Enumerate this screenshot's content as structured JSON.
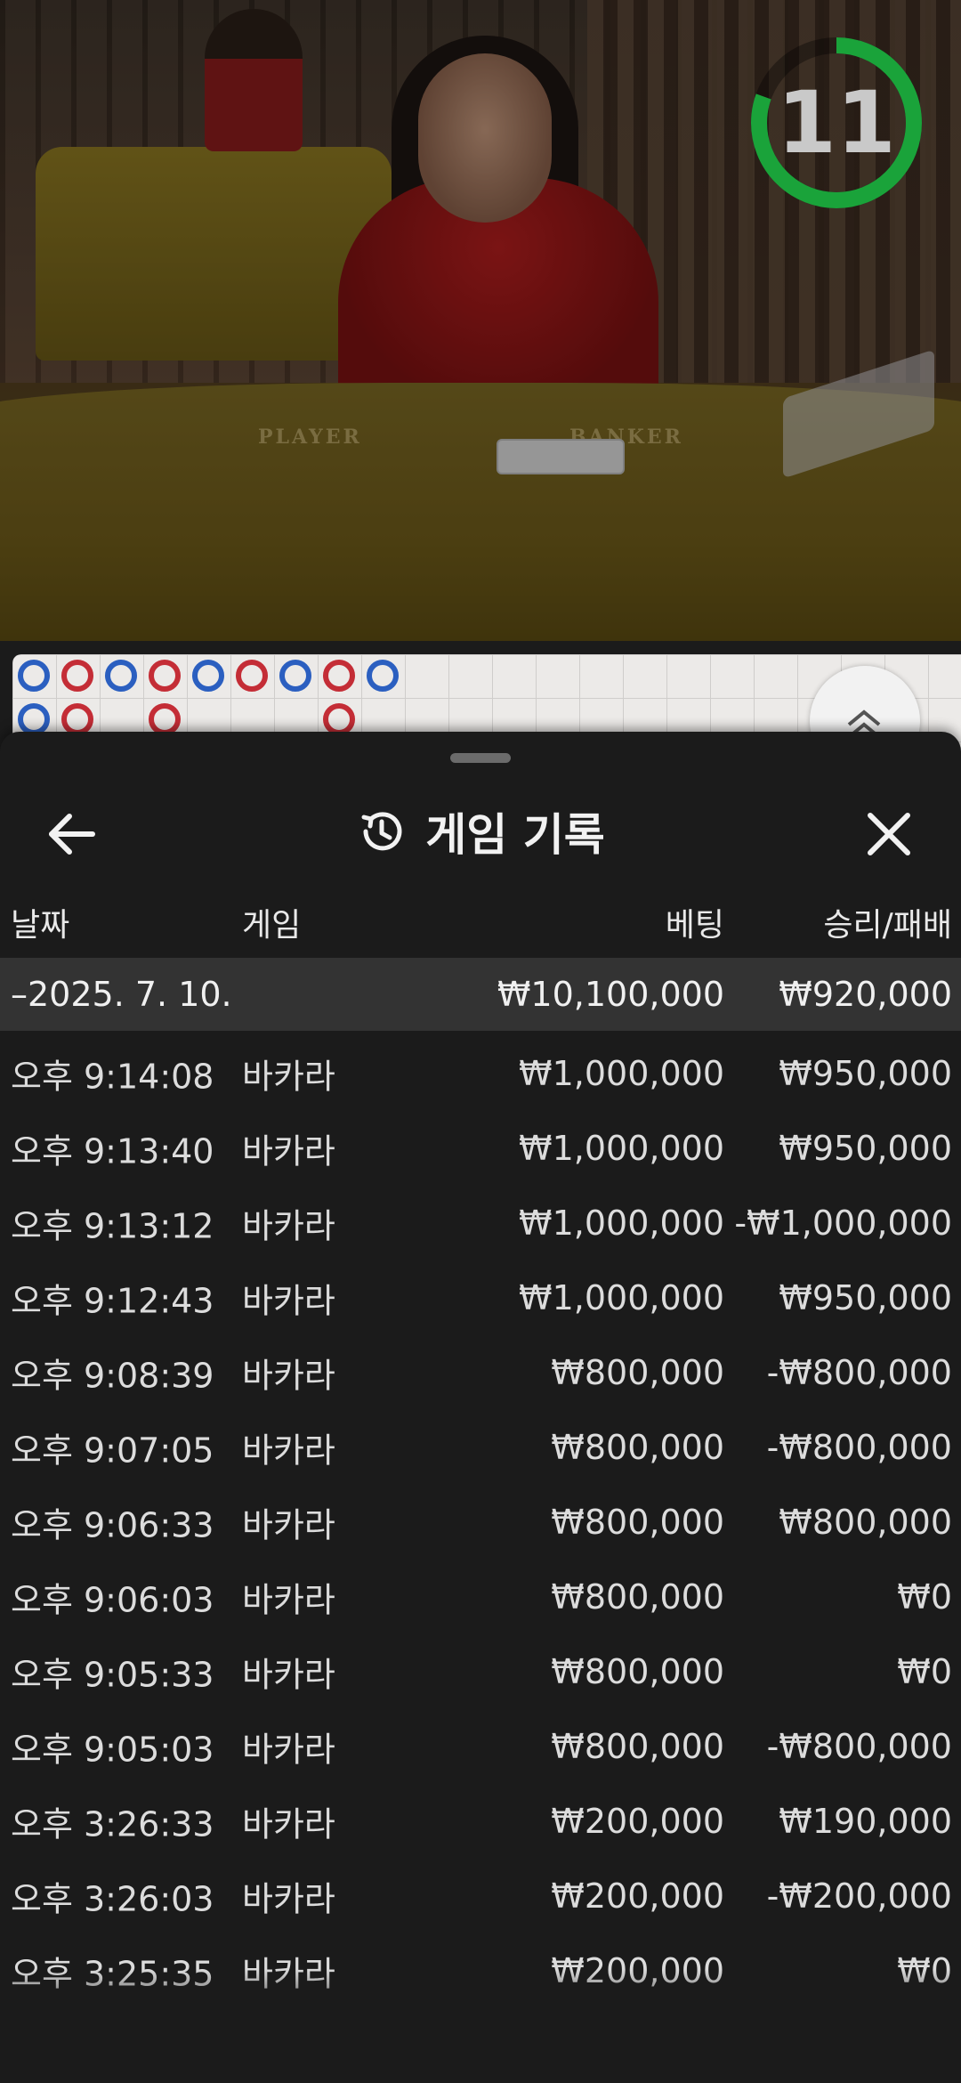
{
  "timer": {
    "value": "11",
    "ring_color": "#1aa33a"
  },
  "bead_road": {
    "colors": {
      "player": "#2b5fc0",
      "banker": "#c42d36"
    },
    "columns": [
      [
        "player",
        "player"
      ],
      [
        "banker",
        "banker"
      ],
      [
        "player"
      ],
      [
        "banker",
        "banker"
      ],
      [
        "player"
      ],
      [
        "banker"
      ],
      [
        "player"
      ],
      [
        "banker",
        "banker"
      ],
      [
        "player"
      ]
    ]
  },
  "video": {
    "felt_left": "PLAYER",
    "felt_right": "BANKER"
  },
  "sheet": {
    "title": "게임 기록",
    "title_icon": "history-icon",
    "back_icon": "arrow-left-icon",
    "close_icon": "close-icon",
    "columns": {
      "date": "날짜",
      "game": "게임",
      "bet": "베팅",
      "result": "승리/패배"
    },
    "date_group": {
      "label": "–2025. 7. 10.",
      "bet_total": "₩10,100,000",
      "result_total": "₩920,000"
    },
    "rows": [
      {
        "time": "오후 9:14:08",
        "game": "바카라",
        "bet": "₩1,000,000",
        "result": "₩950,000"
      },
      {
        "time": "오후 9:13:40",
        "game": "바카라",
        "bet": "₩1,000,000",
        "result": "₩950,000"
      },
      {
        "time": "오후 9:13:12",
        "game": "바카라",
        "bet": "₩1,000,000",
        "result": "-₩1,000,000"
      },
      {
        "time": "오후 9:12:43",
        "game": "바카라",
        "bet": "₩1,000,000",
        "result": "₩950,000"
      },
      {
        "time": "오후 9:08:39",
        "game": "바카라",
        "bet": "₩800,000",
        "result": "-₩800,000"
      },
      {
        "time": "오후 9:07:05",
        "game": "바카라",
        "bet": "₩800,000",
        "result": "-₩800,000"
      },
      {
        "time": "오후 9:06:33",
        "game": "바카라",
        "bet": "₩800,000",
        "result": "₩800,000"
      },
      {
        "time": "오후 9:06:03",
        "game": "바카라",
        "bet": "₩800,000",
        "result": "₩0"
      },
      {
        "time": "오후 9:05:33",
        "game": "바카라",
        "bet": "₩800,000",
        "result": "₩0"
      },
      {
        "time": "오후 9:05:03",
        "game": "바카라",
        "bet": "₩800,000",
        "result": "-₩800,000"
      },
      {
        "time": "오후 3:26:33",
        "game": "바카라",
        "bet": "₩200,000",
        "result": "₩190,000"
      },
      {
        "time": "오후 3:26:03",
        "game": "바카라",
        "bet": "₩200,000",
        "result": "-₩200,000"
      },
      {
        "time": "오후 3:25:35",
        "game": "바카라",
        "bet": "₩200,000",
        "result": "₩0"
      }
    ]
  }
}
